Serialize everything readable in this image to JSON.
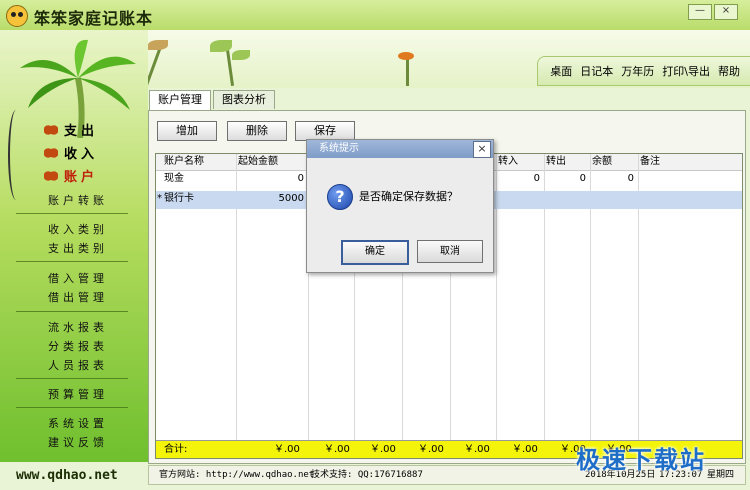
{
  "window": {
    "title": "笨笨家庭记账本",
    "controls": {
      "minimize": "—",
      "close": "×"
    }
  },
  "top_nav": [
    "桌面",
    "日记本",
    "万年历",
    "打印\\导出",
    "帮助"
  ],
  "sidebar": {
    "main_items": [
      "支出",
      "收入",
      "账户"
    ],
    "groups": [
      [
        "账户转账"
      ],
      [
        "收入类别",
        "支出类别"
      ],
      [
        "借入管理",
        "借出管理"
      ],
      [
        "流水报表",
        "分类报表",
        "人员报表"
      ],
      [
        "预算管理"
      ],
      [
        "系统设置",
        "建议反馈"
      ]
    ],
    "website": "www.qdhao.net"
  },
  "tabs": [
    "账户管理",
    "图表分析"
  ],
  "toolbar": {
    "add": "增加",
    "delete": "删除",
    "save": "保存"
  },
  "table": {
    "columns": [
      "账户名称",
      "起始金额",
      "",
      "",
      "",
      "转入",
      "转出",
      "余额",
      "备注"
    ],
    "rows": [
      {
        "marker": "",
        "name": "现金",
        "start": "0",
        "in": "0",
        "out": "0",
        "balance": "0",
        "note": ""
      },
      {
        "marker": "*",
        "name": "银行卡",
        "start": "5000",
        "in": "",
        "out": "",
        "balance": "",
        "note": ""
      }
    ],
    "total_label": "合计:",
    "total_cells": [
      "￥.00",
      "￥.00",
      "￥.00",
      "￥.00",
      "￥.00",
      "￥.00",
      "￥.00",
      "￥.00"
    ]
  },
  "status": {
    "website": "官方网站: http://www.qdhao.net",
    "support": "技术支持: QQ:176716887",
    "date": "2018年10月25日",
    "time": "17:23:07",
    "weekday": "星期四"
  },
  "dialog": {
    "title": "系统提示",
    "message": "是否确定保存数据？",
    "ok": "确定",
    "cancel": "取消",
    "icon": "question-icon"
  },
  "watermark": "极速下载站",
  "colors": {
    "accent_green": "#b9dc6a",
    "selected_row": "#c9d9ef",
    "total_row": "#f4f40a"
  }
}
